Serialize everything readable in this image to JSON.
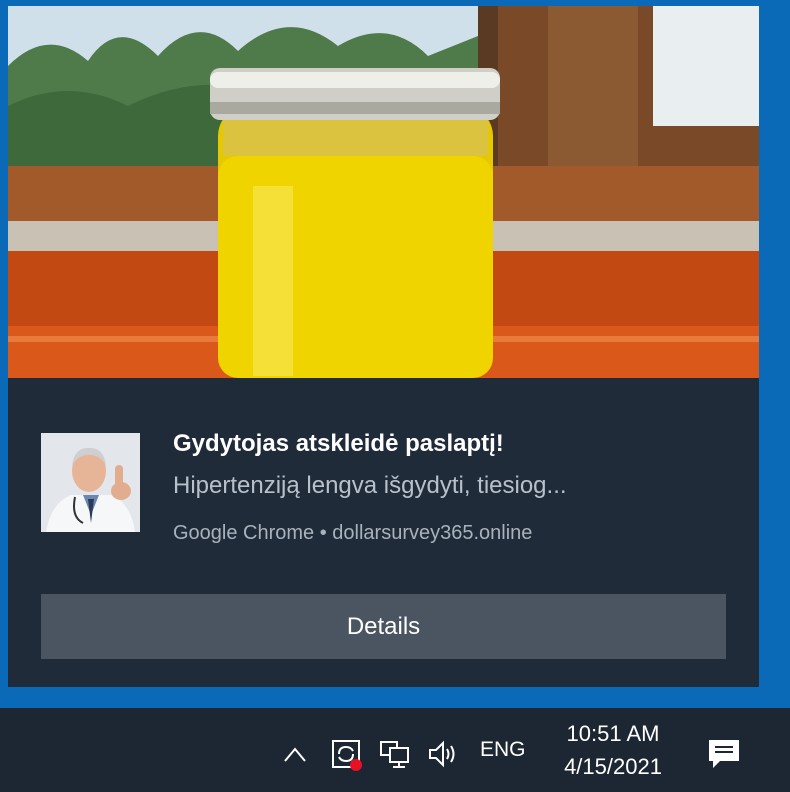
{
  "notification": {
    "title": "Gydytojas atskleidė paslaptį!",
    "text": "Hipertenziją lengva išgydyti, tiesiog...",
    "attribution": "Google Chrome • dollarsurvey365.online",
    "details_label": "Details"
  },
  "taskbar": {
    "language": "ENG",
    "time": "10:51 AM",
    "date": "4/15/2021"
  },
  "icons": {
    "tray_expand": "chevron-up-icon",
    "sync": "sync-alert-icon",
    "network": "network-icon",
    "volume": "volume-icon",
    "action_center": "action-center-icon"
  }
}
